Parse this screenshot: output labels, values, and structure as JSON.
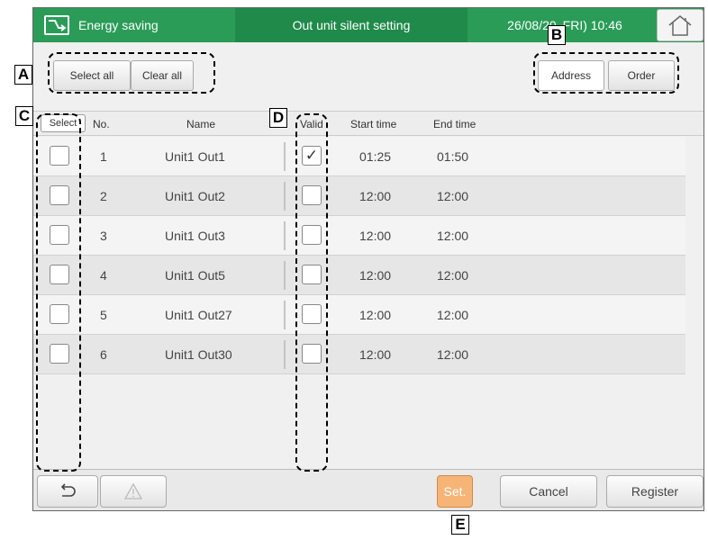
{
  "header": {
    "app_label": "Energy saving",
    "screen_title": "Out unit silent setting",
    "datetime": "26/08/20 FRI) 10:46"
  },
  "toolbar": {
    "select_all_label": "Select all",
    "clear_all_label": "Clear all",
    "address_label": "Address",
    "order_label": "Order"
  },
  "table": {
    "columns": {
      "select": "Select",
      "no": "No.",
      "name": "Name",
      "valid": "Valid",
      "start": "Start time",
      "end": "End time"
    },
    "rows": [
      {
        "no": "1",
        "name": "Unit1 Out1",
        "valid": true,
        "valid_mark": "✓",
        "start": "01:25",
        "end": "01:50"
      },
      {
        "no": "2",
        "name": "Unit1 Out2",
        "valid": false,
        "valid_mark": "",
        "start": "12:00",
        "end": "12:00"
      },
      {
        "no": "3",
        "name": "Unit1 Out3",
        "valid": false,
        "valid_mark": "",
        "start": "12:00",
        "end": "12:00"
      },
      {
        "no": "4",
        "name": "Unit1 Out5",
        "valid": false,
        "valid_mark": "",
        "start": "12:00",
        "end": "12:00"
      },
      {
        "no": "5",
        "name": "Unit1 Out27",
        "valid": false,
        "valid_mark": "",
        "start": "12:00",
        "end": "12:00"
      },
      {
        "no": "6",
        "name": "Unit1 Out30",
        "valid": false,
        "valid_mark": "",
        "start": "12:00",
        "end": "12:00"
      }
    ]
  },
  "footer": {
    "back_icon": "back-arrow-icon",
    "warning_icon": "warning-icon",
    "set_label": "Set.",
    "cancel_label": "Cancel",
    "register_label": "Register"
  },
  "callouts": {
    "a": "A",
    "b": "B",
    "c": "C",
    "d": "D",
    "e": "E"
  },
  "colors": {
    "header_green": "#2a9c57",
    "header_title_bg": "#1f8a49",
    "set_button": "#f6b576"
  }
}
